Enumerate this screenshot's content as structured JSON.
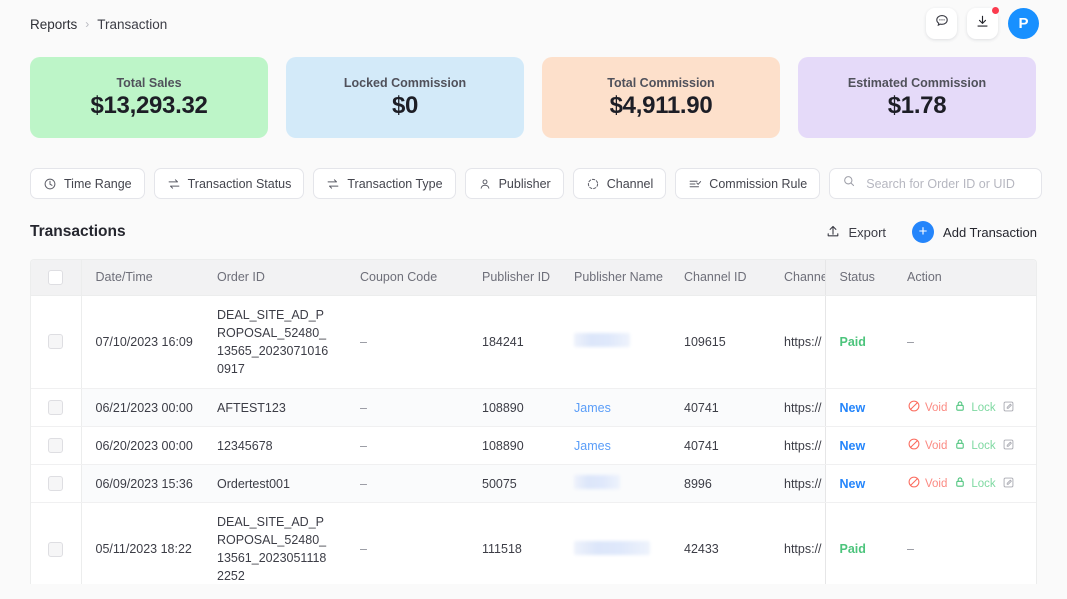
{
  "breadcrumb": {
    "parent": "Reports",
    "separator": "›",
    "current": "Transaction"
  },
  "top_actions": {
    "message_icon": "chat-bubble-icon",
    "download_icon": "download-icon",
    "avatar_initial": "P",
    "avatar_color": "#1890ff",
    "notification_color": "#fb3b4e"
  },
  "cards": [
    {
      "label": "Total Sales",
      "value": "$13,293.32",
      "bg": "#bdf5c8"
    },
    {
      "label": "Locked Commission",
      "value": "$0",
      "bg": "#d3eaf9"
    },
    {
      "label": "Total Commission",
      "value": "$4,911.90",
      "bg": "#fde0cb"
    },
    {
      "label": "Estimated Commission",
      "value": "$1.78",
      "bg": "#e5daf9"
    }
  ],
  "filters": [
    {
      "label": "Time Range",
      "icon": "clock-icon"
    },
    {
      "label": "Transaction Status",
      "icon": "swap-arrows-icon"
    },
    {
      "label": "Transaction Type",
      "icon": "swap-arrows-icon"
    },
    {
      "label": "Publisher",
      "icon": "person-icon"
    },
    {
      "label": "Channel",
      "icon": "dashed-circle-icon"
    },
    {
      "label": "Commission Rule",
      "icon": "list-check-icon"
    }
  ],
  "search": {
    "placeholder": "Search for Order ID or UID",
    "value": "",
    "icon": "search-icon"
  },
  "section": {
    "title": "Transactions",
    "export_label": "Export",
    "export_icon": "upload-icon",
    "add_label": "Add Transaction",
    "add_icon": "plus-icon"
  },
  "table": {
    "columns": [
      "Date/Time",
      "Order ID",
      "Coupon Code",
      "Publisher ID",
      "Publisher Name",
      "Channel ID",
      "Channe",
      "Status",
      "Action"
    ],
    "column_settings_icon": "chevron-down-icon",
    "rows": [
      {
        "datetime": "07/10/2023 16:09",
        "order_id": "DEAL_SITE_AD_PROPOSAL_52480_13565_20230710160917",
        "coupon_code": "–",
        "publisher_id": "184241",
        "publisher_name": "",
        "publisher_name_redacted": true,
        "publisher_name_width": 56,
        "channel_id": "109615",
        "channel": "https://",
        "status": "Paid",
        "status_type": "paid",
        "action": "–",
        "has_actions": false
      },
      {
        "datetime": "06/21/2023 00:00",
        "order_id": "AFTEST123",
        "coupon_code": "–",
        "publisher_id": "108890",
        "publisher_name": "James",
        "publisher_name_redacted": false,
        "channel_id": "40741",
        "channel": "https://",
        "status": "New",
        "status_type": "new",
        "action": "",
        "has_actions": true,
        "void_label": "Void",
        "lock_label": "Lock"
      },
      {
        "datetime": "06/20/2023 00:00",
        "order_id": "12345678",
        "coupon_code": "–",
        "publisher_id": "108890",
        "publisher_name": "James",
        "publisher_name_redacted": false,
        "channel_id": "40741",
        "channel": "https://",
        "status": "New",
        "status_type": "new",
        "action": "",
        "has_actions": true,
        "void_label": "Void",
        "lock_label": "Lock"
      },
      {
        "datetime": "06/09/2023 15:36",
        "order_id": "Ordertest001",
        "coupon_code": "–",
        "publisher_id": "50075",
        "publisher_name": "",
        "publisher_name_redacted": true,
        "publisher_name_width": 46,
        "channel_id": "8996",
        "channel": "https://",
        "status": "New",
        "status_type": "new",
        "action": "",
        "has_actions": true,
        "void_label": "Void",
        "lock_label": "Lock"
      },
      {
        "datetime": "05/11/2023 18:22",
        "order_id": "DEAL_SITE_AD_PROPOSAL_52480_13561_20230511182252",
        "coupon_code": "–",
        "publisher_id": "111518",
        "publisher_name": "",
        "publisher_name_redacted": true,
        "publisher_name_width": 76,
        "channel_id": "42433",
        "channel": "https://",
        "status": "Paid",
        "status_type": "paid",
        "action": "–",
        "has_actions": false
      }
    ]
  },
  "colors": {
    "accent_blue": "#2485fb",
    "status_paid": "#4cc47c",
    "status_new": "#2485fb",
    "void_red": "#fb8a83",
    "lock_green": "#7fd9a2"
  }
}
